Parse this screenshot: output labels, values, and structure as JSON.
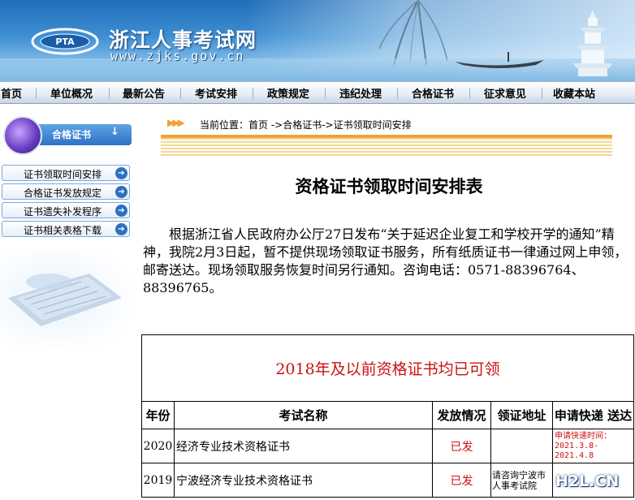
{
  "header": {
    "site_title": "浙江人事考试网",
    "site_url": "www.zjks.gov.cn",
    "logo_text": "PTA"
  },
  "nav": {
    "items": [
      "首页",
      "单位概况",
      "最新公告",
      "考试安排",
      "政策规定",
      "违纪处理",
      "合格证书",
      "征求意见",
      "收藏本站"
    ]
  },
  "sidebar": {
    "title": "合格证书",
    "items": [
      {
        "label": "证书领取时间安排"
      },
      {
        "label": "合格证书发放规定"
      },
      {
        "label": "证书遗失补发程序"
      },
      {
        "label": "证书相关表格下载"
      }
    ]
  },
  "breadcrumb": {
    "text": "当前位置：首页 ->合格证书->证书领取时间安排"
  },
  "main": {
    "title": "资格证书领取时间安排表",
    "notice": "根据浙江省人民政府办公厅27日发布“关于延迟企业复工和学校开学的通知”精神，我院2月3日起，暂不提供现场领取证书服务，所有纸质证书一律通过网上申领，邮寄送达。现场领取服务恢复时间另行通知。咨询电话：0571-88396764、88396765。"
  },
  "table": {
    "banner": "2018年及以前资格证书均已可领",
    "headers": [
      "年份",
      "考试名称",
      "发放情况",
      "领证地址",
      "申请快递 送达"
    ],
    "rows": [
      {
        "year": "2020",
        "name": "经济专业技术资格证书",
        "status": "已发",
        "address": "",
        "request": "申请快递时间：2021.3.8-2021.4.8"
      },
      {
        "year": "2019",
        "name": "宁波经济专业技术资格证书",
        "status": "已发",
        "address": "请咨询宁波市人事考试院",
        "request": ""
      }
    ]
  },
  "watermark": {
    "text": "H2L.CN"
  },
  "colors": {
    "banner_blue": "#3f8fd3",
    "accent_red": "#cc1010",
    "crumb_orange": "#f0a23a",
    "sidebar_blue": "#2d72c4"
  }
}
